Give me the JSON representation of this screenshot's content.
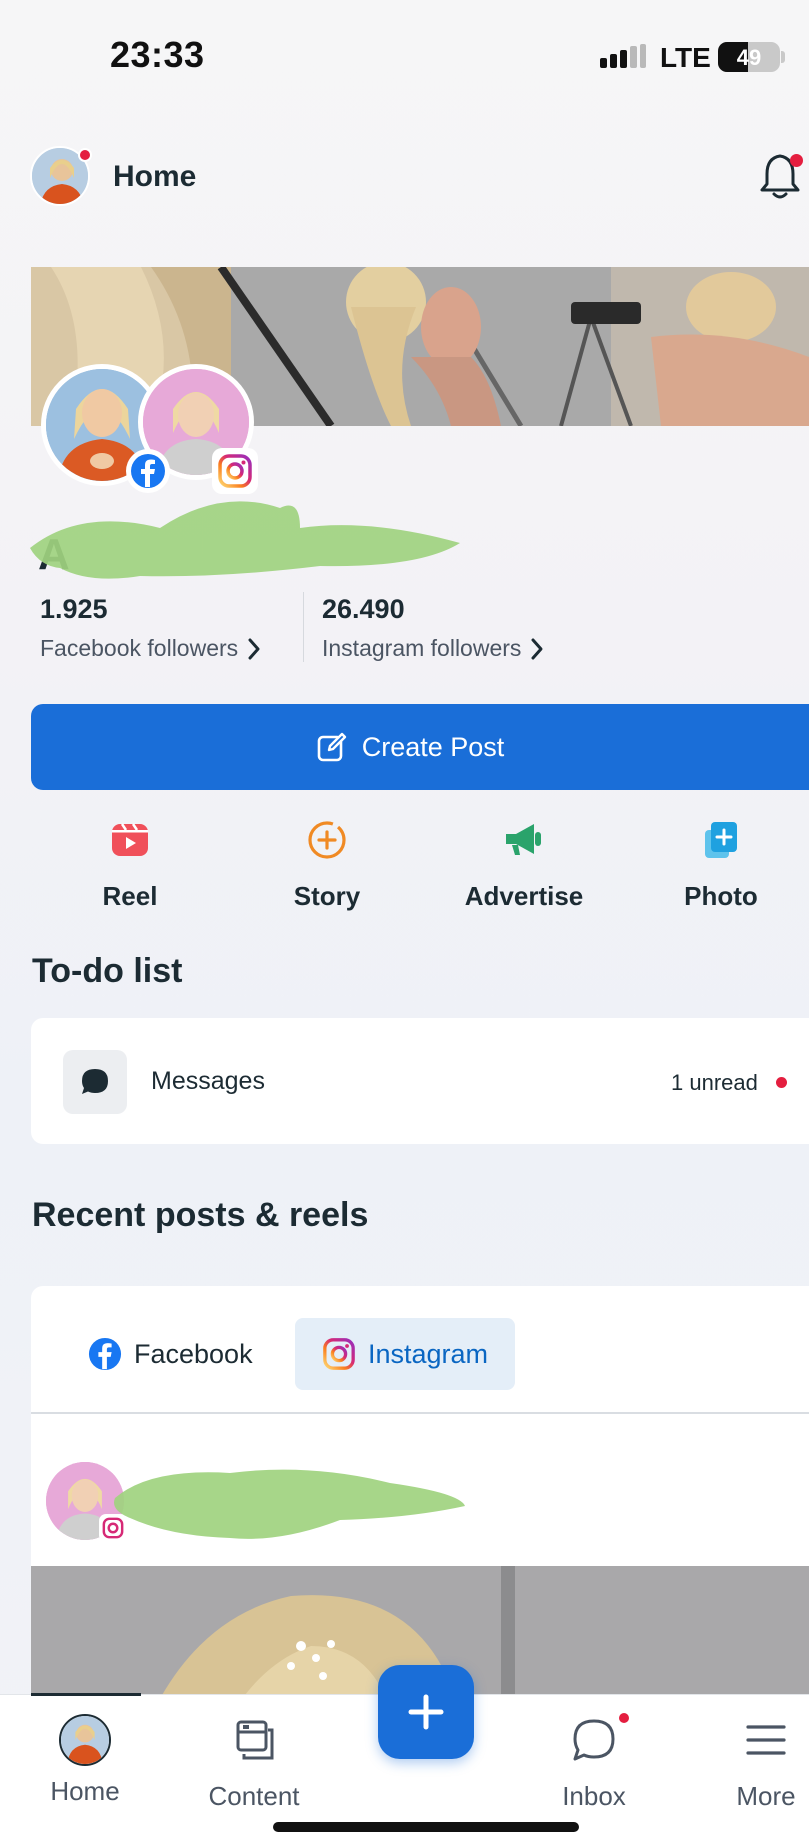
{
  "status_bar": {
    "time": "23:33",
    "network": "LTE",
    "battery": "49"
  },
  "header": {
    "title": "Home",
    "notification_icon": "bell-icon"
  },
  "profile": {
    "name_visible": "A",
    "facebook_followers": {
      "count": "1.925",
      "label": "Facebook followers"
    },
    "instagram_followers": {
      "count": "26.490",
      "label": "Instagram followers"
    }
  },
  "create_post": {
    "label": "Create Post",
    "icon": "edit-icon"
  },
  "quick_actions": [
    {
      "label": "Reel",
      "icon": "reel-icon",
      "color": "#f0505a"
    },
    {
      "label": "Story",
      "icon": "story-add-icon",
      "color": "#f08a24"
    },
    {
      "label": "Advertise",
      "icon": "megaphone-icon",
      "color": "#2aa36b"
    },
    {
      "label": "Photo",
      "icon": "photo-add-icon",
      "color": "#1fa1e0"
    }
  ],
  "todo": {
    "title": "To-do list",
    "items": [
      {
        "label": "Messages",
        "status": "1 unread",
        "icon": "chat-bubble-icon"
      }
    ]
  },
  "recent": {
    "title": "Recent posts & reels",
    "tabs": [
      {
        "label": "Facebook",
        "icon": "facebook-icon",
        "active": false
      },
      {
        "label": "Instagram",
        "icon": "instagram-icon",
        "active": true
      }
    ]
  },
  "bottom_nav": {
    "items": [
      {
        "label": "Home",
        "icon": "avatar-icon"
      },
      {
        "label": "Content",
        "icon": "content-icon"
      },
      {
        "label": "Inbox",
        "icon": "inbox-chat-icon"
      },
      {
        "label": "More",
        "icon": "hamburger-icon"
      }
    ],
    "fab_icon": "plus-icon"
  },
  "colors": {
    "accent": "#1a6ed8",
    "alert": "#e41e3f",
    "redaction": "#9fd37f"
  }
}
